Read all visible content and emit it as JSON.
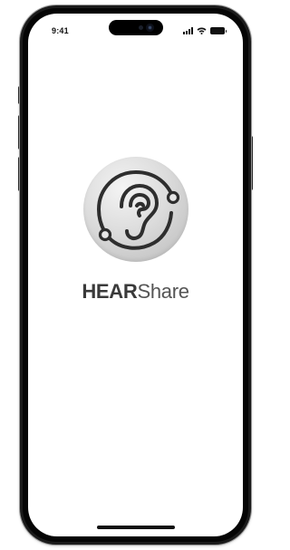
{
  "status_bar": {
    "time": "9:41",
    "signal_icon": "cellular-signal-icon",
    "wifi_icon": "wifi-icon",
    "battery_icon": "battery-icon"
  },
  "splash": {
    "logo_icon": "ear-icon",
    "brand_bold": "HEAR",
    "brand_light": "Share"
  },
  "colors": {
    "badge_light": "#f4f4f4",
    "badge_dark": "#b9b9b9",
    "mark": "#2e2e2e",
    "wordmark": "#444444"
  }
}
